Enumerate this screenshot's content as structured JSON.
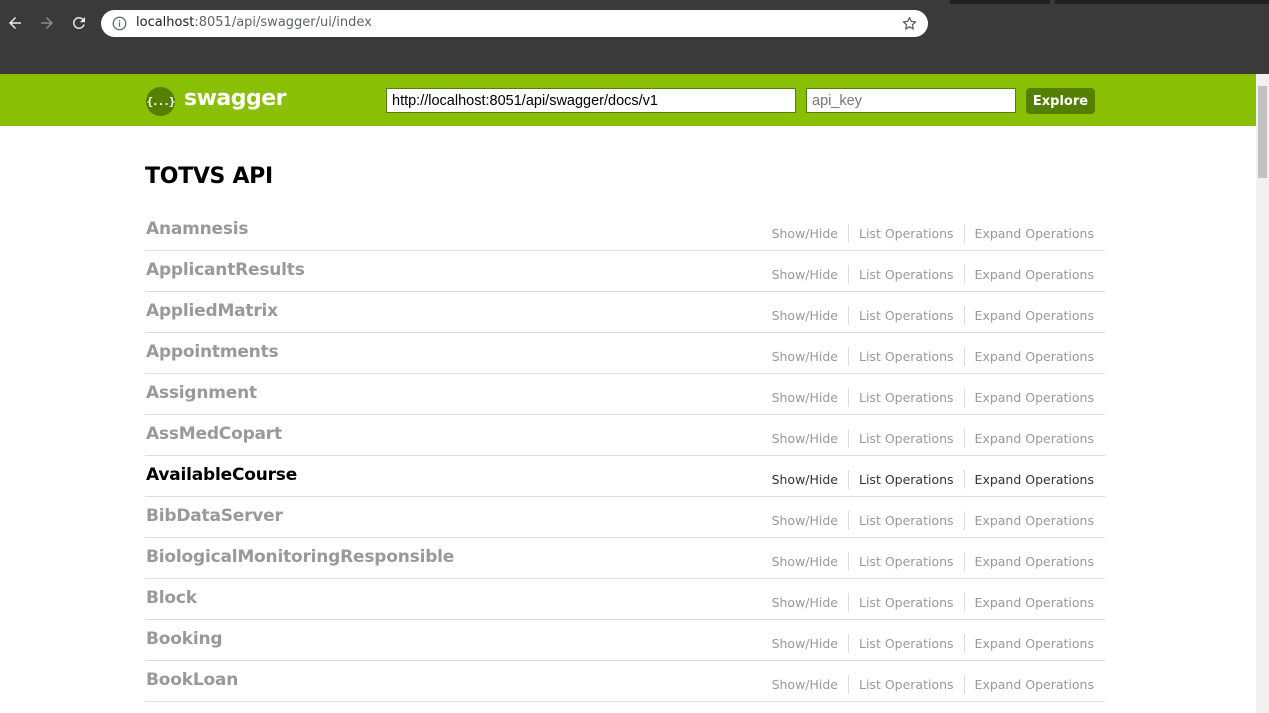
{
  "browser": {
    "url_host": "localhost",
    "url_path": ":8051/api/swagger/ui/index"
  },
  "header": {
    "logo_text": "swagger",
    "logo_glyph": "{...}",
    "url_value": "http://localhost:8051/api/swagger/docs/v1",
    "api_key_placeholder": "api_key",
    "explore_label": "Explore",
    "brand_color": "#89bf04",
    "dark_color": "#547f00"
  },
  "main": {
    "title": "TOTVS API",
    "ops_labels": {
      "show_hide": "Show/Hide",
      "list": "List Operations",
      "expand": "Expand Operations"
    },
    "resources": [
      {
        "name": "Anamnesis",
        "active": false
      },
      {
        "name": "ApplicantResults",
        "active": false
      },
      {
        "name": "AppliedMatrix",
        "active": false
      },
      {
        "name": "Appointments",
        "active": false
      },
      {
        "name": "Assignment",
        "active": false
      },
      {
        "name": "AssMedCopart",
        "active": false
      },
      {
        "name": "AvailableCourse",
        "active": true
      },
      {
        "name": "BibDataServer",
        "active": false
      },
      {
        "name": "BiologicalMonitoringResponsible",
        "active": false
      },
      {
        "name": "Block",
        "active": false
      },
      {
        "name": "Booking",
        "active": false
      },
      {
        "name": "BookLoan",
        "active": false
      }
    ]
  }
}
